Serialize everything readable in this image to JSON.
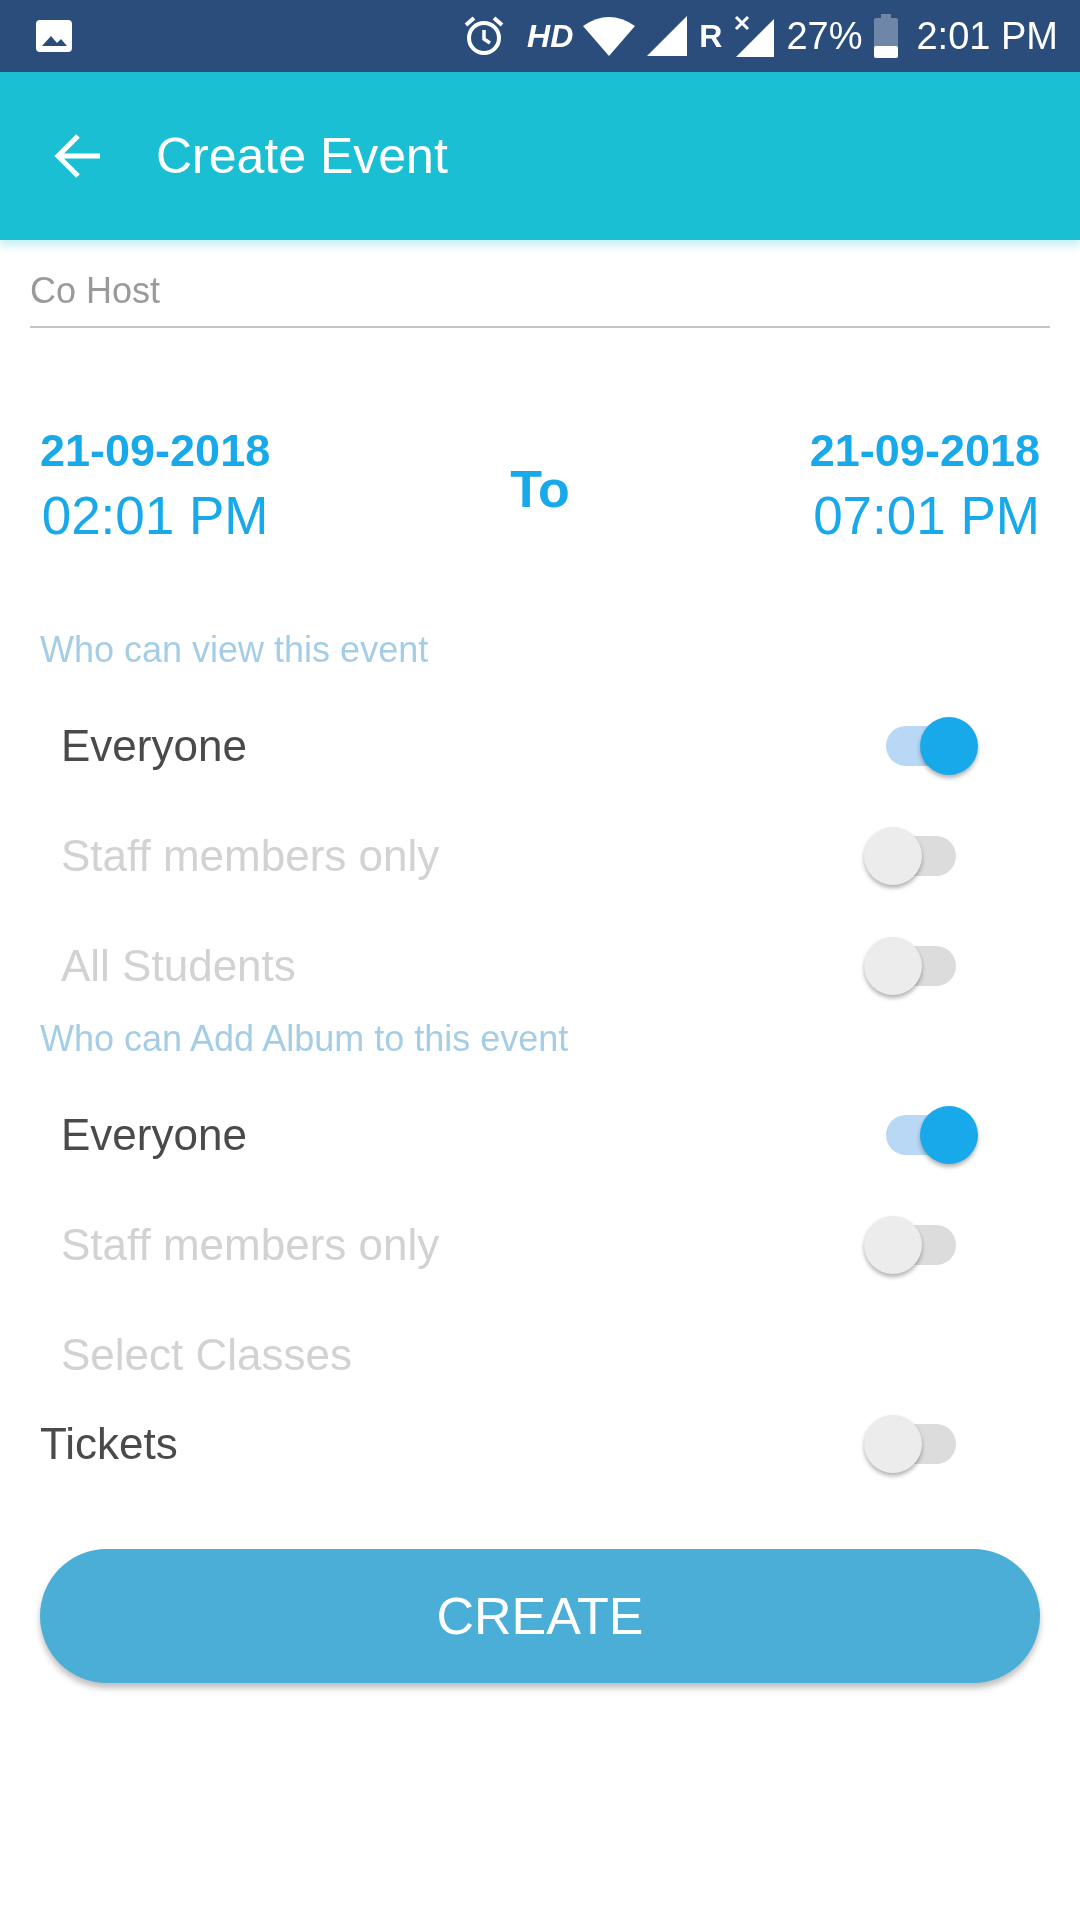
{
  "status_bar": {
    "network": "HD",
    "roaming": "R",
    "battery": "27%",
    "time": "2:01 PM"
  },
  "app_bar": {
    "title": "Create Event"
  },
  "co_host": {
    "placeholder": "Co Host"
  },
  "schedule": {
    "start_date": "21-09-2018",
    "start_time": "02:01 PM",
    "separator": "To",
    "end_date": "21-09-2018",
    "end_time": "07:01 PM"
  },
  "sections": [
    {
      "title": "Who can view this event",
      "options": [
        {
          "kind": "toggle",
          "label": "Everyone",
          "on": true,
          "disabled": false
        },
        {
          "kind": "toggle",
          "label": "Staff members only",
          "on": false,
          "disabled": true
        },
        {
          "kind": "toggle",
          "label": "All Students",
          "on": false,
          "disabled": true
        }
      ]
    },
    {
      "title": "Who can Add Album to this event",
      "options": [
        {
          "kind": "toggle",
          "label": "Everyone",
          "on": true,
          "disabled": false
        },
        {
          "kind": "toggle",
          "label": "Staff members only",
          "on": false,
          "disabled": true
        },
        {
          "kind": "plain",
          "label": "Select Classes",
          "disabled": true
        }
      ]
    }
  ],
  "tickets": {
    "label": "Tickets",
    "on": false
  },
  "create_button": "CREATE"
}
